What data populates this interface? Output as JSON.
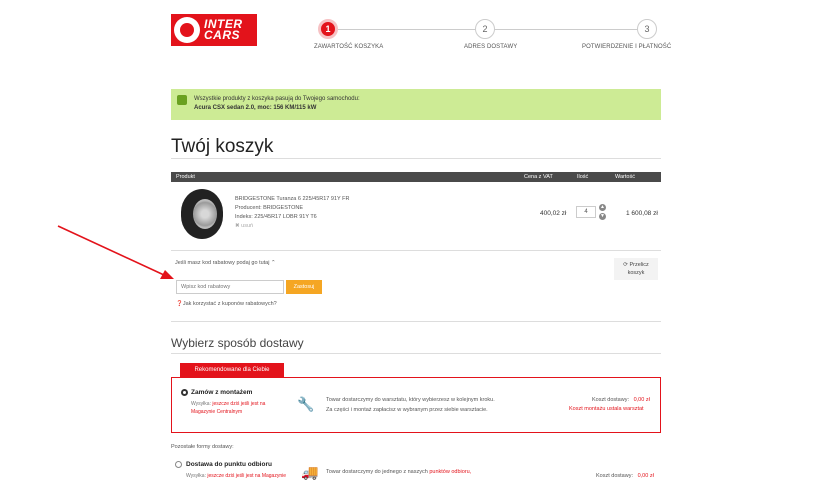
{
  "brand": {
    "line1": "INTER",
    "line2": "CARS"
  },
  "steps": [
    {
      "num": "1",
      "label": "ZAWARTOŚĆ KOSZYKA"
    },
    {
      "num": "2",
      "label": "ADRES DOSTAWY"
    },
    {
      "num": "3",
      "label": "POTWIERDZENIE I PŁATNOŚĆ"
    }
  ],
  "alert": {
    "line1": "Wszystkie produkty z koszyka pasują do Twojego samochodu:",
    "line2": "Acura CSX sedan 2.0, moc: 156 KM/115 kW"
  },
  "cart_title": "Twój koszyk",
  "table": {
    "headers": {
      "product": "Produkt",
      "price": "Cena z VAT",
      "qty": "Ilość",
      "value": "Wartość"
    },
    "row": {
      "name": "BRIDGESTONE Turanza 6 225/45R17 91Y FR",
      "producer": "Producent: BRIDGESTONE",
      "index": "Indeks: 225/45R17 LOBR 91Y T6",
      "remove": "usuń",
      "price": "400,02 zł",
      "qty": "4",
      "total": "1 600,08 zł"
    }
  },
  "discount": {
    "question": "Jeśli masz kod rabatowy podaj go tutaj",
    "placeholder": "Wpisz kod rabatowy",
    "apply": "Zastosuj",
    "help": "Jak korzystać z kuponów rabatowych?",
    "recalc_line1": "Przelicz",
    "recalc_line2": "koszyk"
  },
  "shipping": {
    "title": "Wybierz sposób dostawy",
    "recommended_tab": "Rekomendowane dla Ciebie",
    "option1": {
      "title": "Zamów z montażem",
      "sub_prefix": "Wysyłka:",
      "sub_link": "jeszcze dziś jeśli jest na",
      "sub_link2": "Magazynie Centralnym",
      "desc1": "Towar dostarczymy do warsztatu, który wybierzesz w kolejnym kroku.",
      "desc2": "Za części i montaż zapłacisz w wybranym przez siebie warsztacie.",
      "cost_label": "Koszt dostawy:",
      "cost_value": "0,00 zł",
      "install_note": "Koszt montażu ustala warsztat"
    },
    "others_label": "Pozostałe formy dostawy:",
    "option2": {
      "title": "Dostawa do punktu odbioru",
      "sub_prefix": "Wysyłka:",
      "sub_link": "jeszcze dziś jeśli jest na Magazynie",
      "desc": "Towar dostarczymy do jednego z naszych",
      "desc_link": "punktów odbioru,",
      "cost_label": "Koszt dostawy:",
      "cost_value": "0,00 zł"
    }
  },
  "colors": {
    "brand_red": "#e3131b",
    "alert_green": "#cdeb95",
    "apply_orange": "#f5a623"
  }
}
